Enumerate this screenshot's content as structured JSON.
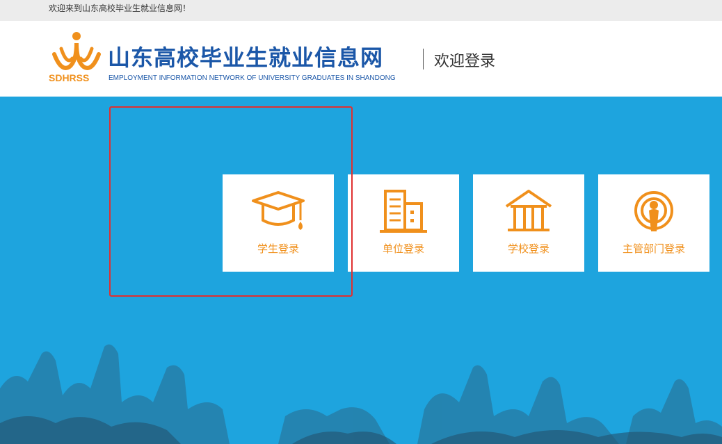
{
  "topbar": {
    "welcome": "欢迎来到山东高校毕业生就业信息网！"
  },
  "header": {
    "logo_text": "SDHRSS",
    "site_title": "山东高校毕业生就业信息网",
    "site_subtitle": "EMPLOYMENT INFORMATION NETWORK OF UNIVERSITY GRADUATES IN SHANDONG",
    "page_title": "欢迎登录"
  },
  "login_options": [
    {
      "label": "学生登录",
      "icon": "graduation-cap-icon"
    },
    {
      "label": "单位登录",
      "icon": "building-icon"
    },
    {
      "label": "学校登录",
      "icon": "school-icon"
    },
    {
      "label": "主管部门登录",
      "icon": "broadcast-person-icon"
    }
  ],
  "colors": {
    "brand_blue": "#1b57a8",
    "accent_orange": "#f0901c",
    "hero_blue": "#1ea4de",
    "highlight_red": "#e03030"
  }
}
